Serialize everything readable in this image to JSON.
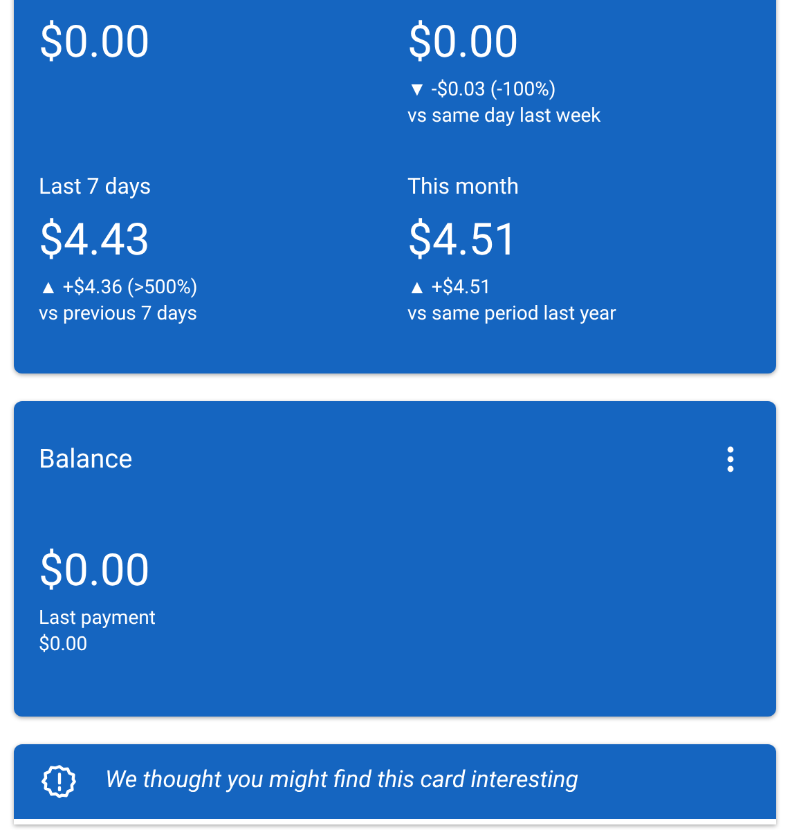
{
  "summary": {
    "stats": [
      {
        "value": "$0.00"
      },
      {
        "value": "$0.00",
        "change": "▼ -$0.03 (-100%)",
        "comparison": "vs same day last week"
      },
      {
        "label": "Last 7 days",
        "value": "$4.43",
        "change": "▲ +$4.36 (>500%)",
        "comparison": "vs previous 7 days"
      },
      {
        "label": "This month",
        "value": "$4.51",
        "change": "▲ +$4.51",
        "comparison": "vs same period last year"
      }
    ]
  },
  "balance": {
    "title": "Balance",
    "value": "$0.00",
    "caption": "Last payment",
    "caption_value": "$0.00"
  },
  "suggestion": {
    "text": "We thought you might find this card interesting"
  }
}
